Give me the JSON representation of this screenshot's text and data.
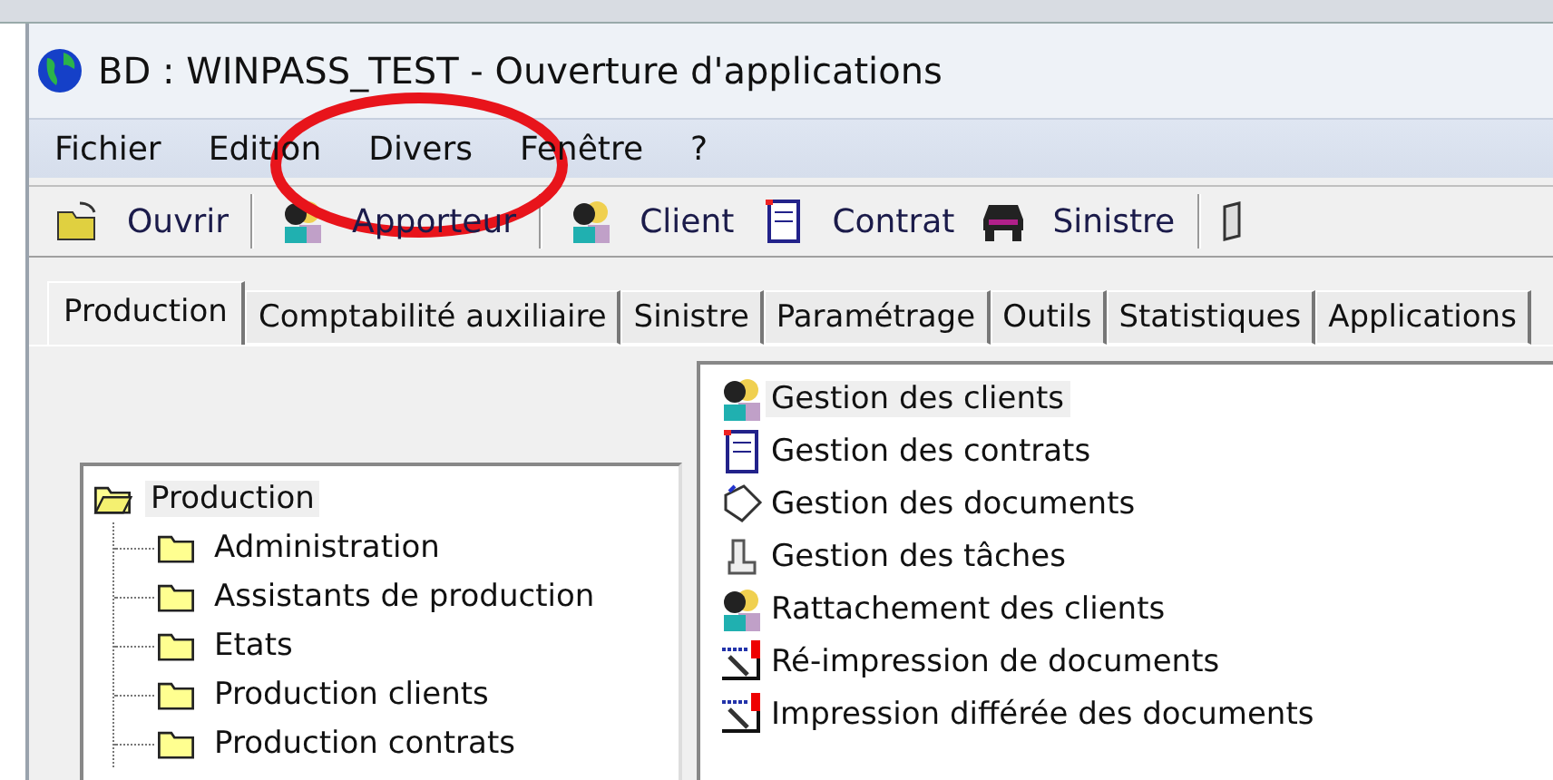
{
  "window": {
    "title": "BD : WINPASS_TEST - Ouverture d'applications"
  },
  "menu": [
    "Fichier",
    "Edition",
    "Divers",
    "Fenêtre",
    "?"
  ],
  "toolbar": [
    {
      "kind": "icon"
    },
    {
      "kind": "text",
      "label": "Ouvrir"
    },
    {
      "kind": "separator"
    },
    {
      "kind": "icon"
    },
    {
      "kind": "text",
      "label": "Apporteur"
    },
    {
      "kind": "separator"
    },
    {
      "kind": "icon"
    },
    {
      "kind": "text",
      "label": "Client"
    },
    {
      "kind": "icon"
    },
    {
      "kind": "text",
      "label": "Contrat"
    },
    {
      "kind": "icon"
    },
    {
      "kind": "text",
      "label": "Sinistre"
    },
    {
      "kind": "separator"
    },
    {
      "kind": "icon"
    }
  ],
  "tabs": [
    {
      "label": "Production",
      "selected": true
    },
    {
      "label": "Comptabilité auxiliaire",
      "selected": false
    },
    {
      "label": "Sinistre",
      "selected": false
    },
    {
      "label": "Paramétrage",
      "selected": false
    },
    {
      "label": "Outils",
      "selected": false
    },
    {
      "label": "Statistiques",
      "selected": false
    },
    {
      "label": "Applications",
      "selected": false
    }
  ],
  "tree": {
    "label": "Production",
    "expanded": true,
    "selected": true,
    "children": [
      {
        "label": "Administration"
      },
      {
        "label": "Assistants de production"
      },
      {
        "label": "Etats"
      },
      {
        "label": "Production clients"
      },
      {
        "label": "Production contrats"
      }
    ]
  },
  "applications": [
    {
      "label": "Gestion des clients",
      "selected": true
    },
    {
      "label": "Gestion des contrats",
      "selected": false
    },
    {
      "label": "Gestion des documents",
      "selected": false
    },
    {
      "label": "Gestion des tâches",
      "selected": false
    },
    {
      "label": "Rattachement des clients",
      "selected": false
    },
    {
      "label": "Ré-impression de documents",
      "selected": false
    },
    {
      "label": "Impression différée des documents",
      "selected": false
    }
  ],
  "annotation": {
    "kind": "ellipse",
    "color": "#e8141b"
  }
}
